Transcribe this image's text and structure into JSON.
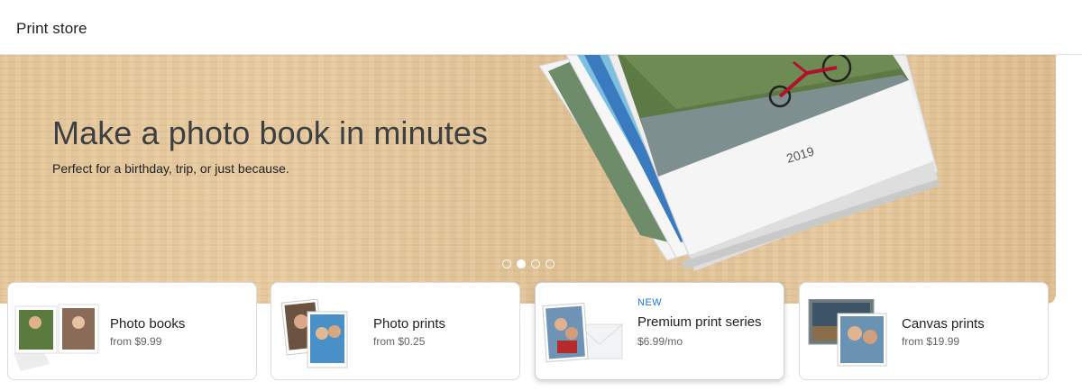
{
  "header": {
    "title": "Print store"
  },
  "hero": {
    "headline": "Make a photo book in minutes",
    "subline": "Perfect for a birthday, trip, or just because.",
    "book_cover_text": "2019",
    "carousel": {
      "count": 4,
      "active_index": 1
    }
  },
  "products": [
    {
      "name": "Photo books",
      "price": "from $9.99",
      "badge": ""
    },
    {
      "name": "Photo prints",
      "price": "from $0.25",
      "badge": ""
    },
    {
      "name": "Premium print series",
      "price": "$6.99/mo",
      "badge": "NEW"
    },
    {
      "name": "Canvas prints",
      "price": "from $19.99",
      "badge": ""
    }
  ],
  "colors": {
    "accent": "#1a73e8",
    "text": "#202124",
    "muted": "#5f6368"
  }
}
